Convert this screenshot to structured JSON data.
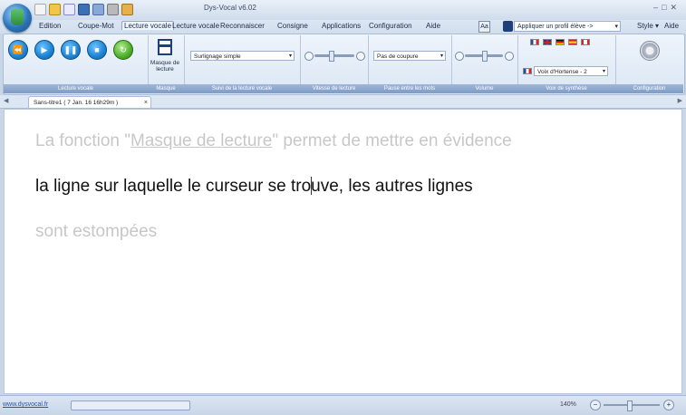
{
  "app": {
    "title": "Dys-Vocal v6.02"
  },
  "menu": [
    {
      "label": "Edition"
    },
    {
      "label": "Coupe-Mot"
    },
    {
      "label": "Lecture vocale",
      "active": true
    },
    {
      "label": "Lecture vocale"
    },
    {
      "label": "Reconnaiscer"
    },
    {
      "label": "Consigne"
    },
    {
      "label": "Applications"
    },
    {
      "label": "Configuration"
    },
    {
      "label": "Aide"
    }
  ],
  "profile": {
    "value": "Appliquer un profil élève ->"
  },
  "right_menu": {
    "style": "Style ▾",
    "help": "Aide"
  },
  "ribbon": {
    "groups": {
      "lecture_vocale": "Lecture vocale",
      "masque": "Masque",
      "suivi": "Suivi de la lecture vocale",
      "vitesse": "Vitesse de lecture",
      "pause": "Pause entre les mots",
      "volume": "Volume",
      "voix": "Voix de synthèse",
      "config": "Configuration"
    },
    "buttons": {
      "rewind": "⏪",
      "play": "▶",
      "pause": "❚❚",
      "stop": "■",
      "refresh": "↻"
    },
    "masque_label": "Masque de lecture",
    "suivi_value": "Surlignage simple",
    "pause_value": "Pas de coupure",
    "voice_value": "Voix d'Hortense - 2",
    "accent_color": "#1b83d4"
  },
  "tab": {
    "label": "Sans-titre1 ( 7 Jan. 16  16h29m )",
    "close": "×"
  },
  "document": {
    "line1_before": "La fonction \"",
    "line1_link": "Masque de lecture",
    "line1_after": "\" permet de mettre en évidence",
    "line2_a": "la ligne sur laquelle le curseur se tro",
    "line2_b": "uve, les autres lignes",
    "line3": "sont estompées"
  },
  "status": {
    "site": "www.dysvocal.fr",
    "zoom": "140%",
    "minus": "−",
    "plus": "+"
  }
}
